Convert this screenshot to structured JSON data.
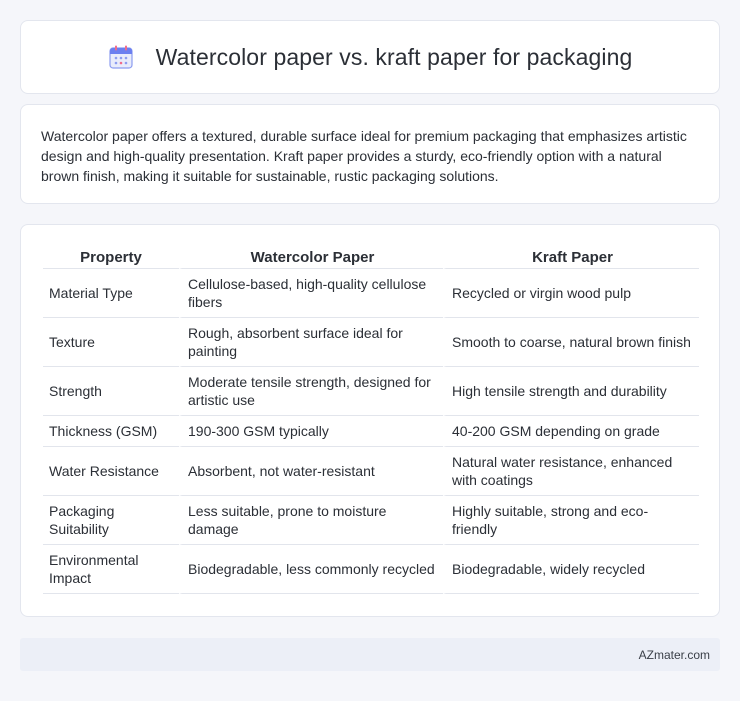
{
  "header": {
    "icon": "calendar-icon",
    "title": "Watercolor paper vs. kraft paper for packaging"
  },
  "summary": {
    "text": "Watercolor paper offers a textured, durable surface ideal for premium packaging that emphasizes artistic design and high-quality presentation. Kraft paper provides a sturdy, eco-friendly option with a natural brown finish, making it suitable for sustainable, rustic packaging solutions."
  },
  "table": {
    "headers": [
      "Property",
      "Watercolor Paper",
      "Kraft Paper"
    ],
    "rows": [
      [
        "Material Type",
        "Cellulose-based, high-quality cellulose fibers",
        "Recycled or virgin wood pulp"
      ],
      [
        "Texture",
        "Rough, absorbent surface ideal for painting",
        "Smooth to coarse, natural brown finish"
      ],
      [
        "Strength",
        "Moderate tensile strength, designed for artistic use",
        "High tensile strength and durability"
      ],
      [
        "Thickness (GSM)",
        "190-300 GSM typically",
        "40-200 GSM depending on grade"
      ],
      [
        "Water Resistance",
        "Absorbent, not water-resistant",
        "Natural water resistance, enhanced with coatings"
      ],
      [
        "Packaging Suitability",
        "Less suitable, prone to moisture damage",
        "Highly suitable, strong and eco-friendly"
      ],
      [
        "Environmental Impact",
        "Biodegradable, less commonly recycled",
        "Biodegradable, widely recycled"
      ]
    ]
  },
  "footer": {
    "text": "AZmater.com"
  },
  "colors": {
    "background": "#f5f6fa",
    "card": "#ffffff",
    "footer": "#eceff7",
    "icon_primary": "#6b7ff0",
    "icon_accent": "#f06b8a"
  }
}
